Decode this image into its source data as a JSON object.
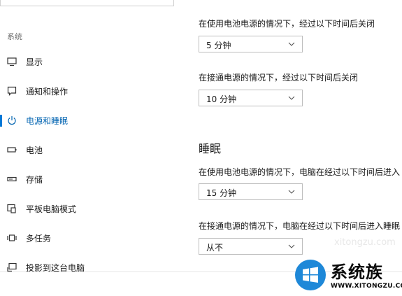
{
  "sidebar": {
    "section_title": "系统",
    "items": [
      {
        "label": "显示",
        "icon": "monitor-icon"
      },
      {
        "label": "通知和操作",
        "icon": "notification-icon"
      },
      {
        "label": "电源和睡眠",
        "icon": "power-icon",
        "active": true
      },
      {
        "label": "电池",
        "icon": "battery-icon"
      },
      {
        "label": "存储",
        "icon": "storage-icon"
      },
      {
        "label": "平板电脑模式",
        "icon": "tablet-mode-icon"
      },
      {
        "label": "多任务",
        "icon": "multitasking-icon"
      },
      {
        "label": "投影到这台电脑",
        "icon": "project-icon"
      }
    ]
  },
  "screen": {
    "battery_desc": "在使用电池电源的情况下，经过以下时间后关闭",
    "battery_value": "5 分钟",
    "plugged_desc": "在接通电源的情况下，经过以下时间后关闭",
    "plugged_value": "10 分钟"
  },
  "sleep": {
    "heading": "睡眠",
    "battery_desc": "在使用电池电源的情况下，电脑在经过以下时间后进入",
    "battery_value": "15 分钟",
    "plugged_desc": "在接通电源的情况下，电脑在经过以下时间后进入睡眠",
    "plugged_value": "从不"
  },
  "watermark": {
    "brand": "系统族",
    "site": "WWW.XITONGZU.COM",
    "faint": "xitongzu.com"
  },
  "colors": {
    "accent": "#0078d7",
    "active_text": "#0063b1",
    "logo_blue": "#1e88d8"
  }
}
